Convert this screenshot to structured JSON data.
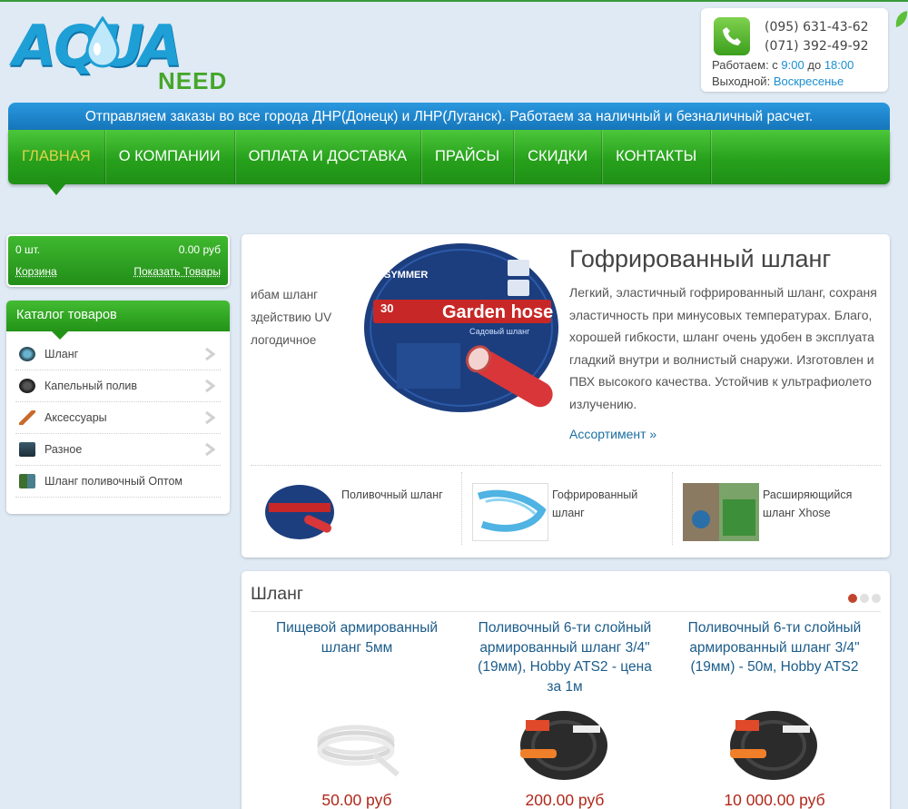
{
  "brand": {
    "logo_main": "AQUA",
    "logo_sub": "NEED"
  },
  "contact": {
    "phone1": "(095) 631-43-62",
    "phone2": "(071) 392-49-92",
    "hours_prefix": "Работаем: с",
    "hours_from": "9:00",
    "hours_mid": "до",
    "hours_to": "18:00",
    "dayoff_prefix": "Выходной:",
    "dayoff_value": "Воскресенье"
  },
  "notice": "Отправляем заказы во все города ДНР(Донецк) и ЛНР(Луганск). Работаем за наличный и безналичный расчет.",
  "menu": [
    {
      "label": "Главная"
    },
    {
      "label": "О компании"
    },
    {
      "label": "Оплата и доставка"
    },
    {
      "label": "Прайсы"
    },
    {
      "label": "Скидки"
    },
    {
      "label": "Контакты"
    }
  ],
  "cart": {
    "qty": "0 шт.",
    "sum": "0.00 руб",
    "basket_label": "Корзина",
    "show_label": "Показать Товары"
  },
  "catalog": {
    "title": "Каталог товаров",
    "items": [
      {
        "label": "Шланг",
        "icon": "hose-icon"
      },
      {
        "label": "Капельный полив",
        "icon": "drip-icon"
      },
      {
        "label": "Аксессуары",
        "icon": "accessory-icon"
      },
      {
        "label": "Разное",
        "icon": "misc-icon"
      },
      {
        "label": "Шланг поливочный Оптом",
        "icon": "wholesale-icon"
      }
    ]
  },
  "slider": {
    "prev_lines": [
      "ибам шланг",
      "здействию UV",
      "логодичное"
    ],
    "title": "Гофрированный шланг",
    "desc_lines": [
      "Легкий, эластичный гофрированный шланг, сохраня",
      "эластичность при минусовых температурах. Благо,",
      "хорошей гибкости, шланг очень удобен в эксплуата",
      "гладкий внутри и волнистый снаружи. Изготовлен и",
      "ПВХ высокого качества. Устойчив к ультрафиолето",
      "излучению."
    ],
    "more": "Ассортимент »",
    "disc_brand": "SYMMER",
    "disc_text": "Garden hose",
    "disc_sub": "Садовый шланг",
    "disc_len": "30",
    "thumbs": [
      {
        "caption": "Поливочный шланг"
      },
      {
        "caption": "Гофрированный шланг"
      },
      {
        "caption": "Расширяющийся шланг Xhose"
      }
    ]
  },
  "products": {
    "title": "Шланг",
    "active_page": 1,
    "pages": 3,
    "items": [
      {
        "name": "Пищевой армированный шланг 5мм",
        "price": "50.00 руб"
      },
      {
        "name": "Поливочный 6-ти слойный армированный шланг 3/4\" (19мм), Hobby ATS2 - цена за 1м",
        "price": "200.00 руб"
      },
      {
        "name": "Поливочный 6-ти слойный армированный шланг 3/4\" (19мм) - 50м, Hobby ATS2",
        "price": "10 000.00 руб"
      }
    ]
  },
  "colors": {
    "accent_green": "#27a11c",
    "accent_blue": "#1a8fd1",
    "price_red": "#b0271a"
  }
}
